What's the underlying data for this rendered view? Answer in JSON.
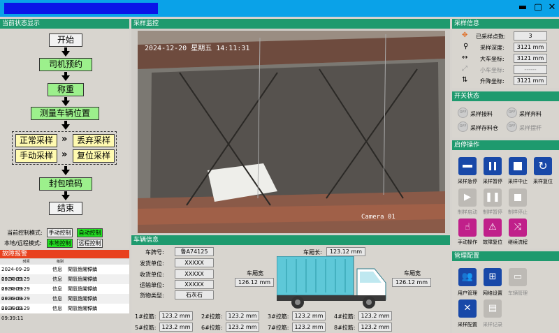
{
  "window": {
    "title": "",
    "minimize": "▬",
    "maximize": "▢",
    "close": "✕"
  },
  "status_panel": {
    "title": "当前状态显示"
  },
  "flow": {
    "start": "开始",
    "reserve": "司机预约",
    "weigh": "称重",
    "measure": "测量车辆位置",
    "normal": "正常采样",
    "discard": "丢弃采样",
    "manual": "手动采样",
    "reset": "复位采样",
    "seal": "封包喷码",
    "end": "结束",
    "swap": "»"
  },
  "mode": {
    "control_label": "当前控制模式:",
    "manual_ctrl": "手动控制",
    "auto_ctrl": "自动控制",
    "remote_label": "本地/远程模式:",
    "local_ctrl": "本地控制",
    "remote_ctrl": "远程控制"
  },
  "alarm": {
    "title": "故障报警",
    "headers": [
      "时间",
      "级别"
    ],
    "rows": [
      [
        "2024-09-29 09:39:11",
        "信息",
        "閘氫佹闂镡鎮"
      ],
      [
        "2024-09-29 09:39:11",
        "信息",
        "閘氫佹闂镡鎮"
      ],
      [
        "2024-09-29 09:39:11",
        "信息",
        "閘氫佹闂镡鎮"
      ],
      [
        "2024-09-29 09:39:11",
        "信息",
        "閘氫佹闂镡鎮"
      ],
      [
        "2024-09-29 09:39:11",
        "信息",
        "閘氫佹闂镡鎮"
      ]
    ]
  },
  "monitor": {
    "title": "采样监控",
    "datetime": "2024-12-20 星期五 14:11:31",
    "camera": "Camera 01"
  },
  "vehicle": {
    "title": "车辆信息",
    "plate_label": "车牌号:",
    "plate": "鲁A74125",
    "sender_label": "发货单位:",
    "sender": "XXXXX",
    "receiver_label": "收货单位:",
    "receiver": "XXXXX",
    "transport_label": "运输单位:",
    "transport": "XXXXX",
    "cargo_label": "货物类型:",
    "cargo": "石灰石",
    "length_label": "车厢长:",
    "length": "123.12 mm",
    "width_label_left": "车厢宽",
    "width_left": "126.12 mm",
    "width_label_right": "车厢宽",
    "width_right": "126.12 mm",
    "bars": [
      {
        "label": "1#拉筋:",
        "value": "123.2 mm"
      },
      {
        "label": "2#拉筋:",
        "value": "123.2 mm"
      },
      {
        "label": "3#拉筋:",
        "value": "123.2 mm"
      },
      {
        "label": "4#拉筋:",
        "value": "123.2 mm"
      },
      {
        "label": "5#拉筋:",
        "value": "123.2 mm"
      },
      {
        "label": "6#拉筋:",
        "value": "123.2 mm"
      },
      {
        "label": "7#拉筋:",
        "value": "123.2 mm"
      },
      {
        "label": "8#拉筋:",
        "value": "123.2 mm"
      }
    ]
  },
  "sampling": {
    "title": "采样信息",
    "rows": [
      {
        "label": "已采样点数:",
        "value": "3"
      },
      {
        "label": "采样深度:",
        "value": "3121 mm"
      },
      {
        "label": "大车坐标:",
        "value": "3121 mm"
      },
      {
        "label": "小车坐标:",
        "value": "------"
      },
      {
        "label": "升降坐标:",
        "value": "3121 mm"
      }
    ]
  },
  "switches": {
    "title": "开关状态",
    "off": "OFF",
    "items": [
      "采样接料",
      "采样弃料",
      "采样存料仓",
      "采样摆杆"
    ]
  },
  "ops": {
    "title": "启停操作",
    "items": [
      "采样急停",
      "采样暂停",
      "采样中止",
      "采样复位",
      "制样启动",
      "制样暂停",
      "制样停止",
      "手动操作",
      "故障复位",
      "继续流程"
    ]
  },
  "mgmt": {
    "title": "管理配置",
    "items": [
      "用户管理",
      "网络设置",
      "车辆管理",
      "采样配置",
      "采样记录"
    ]
  },
  "colors": {
    "accent": "#1e9a6e",
    "alarm": "#e8411e",
    "ok": "#22e022",
    "btn": "#1848a8"
  }
}
